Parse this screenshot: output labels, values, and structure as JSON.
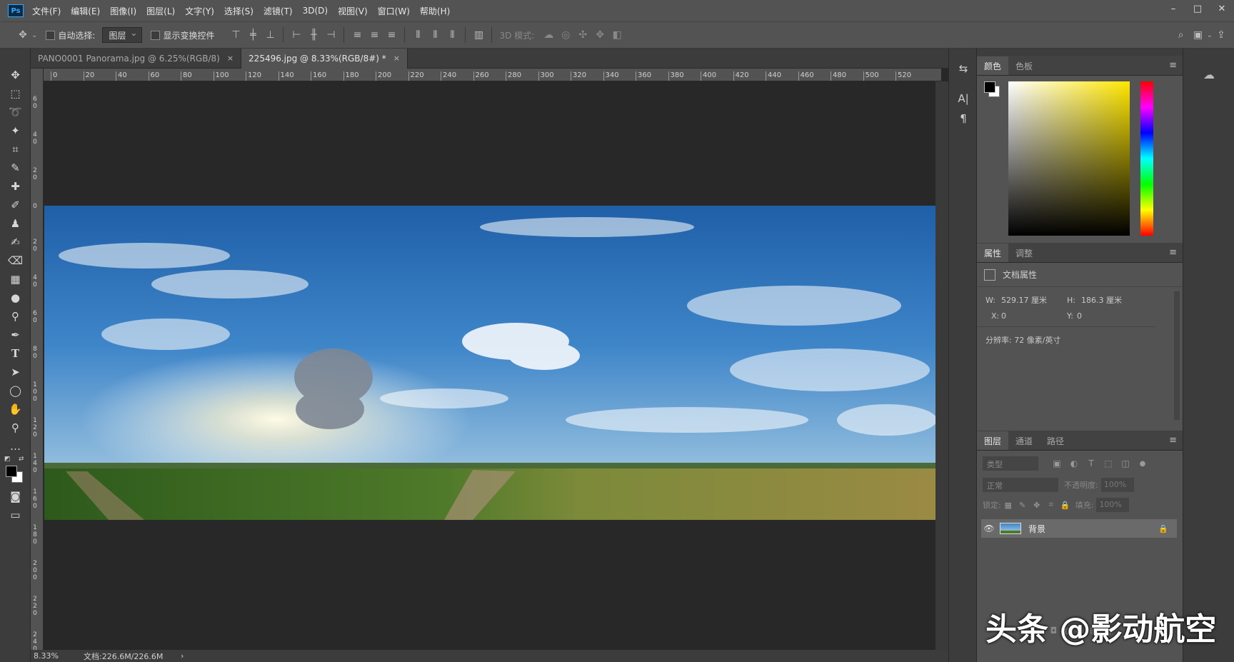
{
  "menu": {
    "app_logo": "Ps",
    "items": [
      "文件(F)",
      "编辑(E)",
      "图像(I)",
      "图层(L)",
      "文字(Y)",
      "选择(S)",
      "滤镜(T)",
      "3D(D)",
      "视图(V)",
      "窗口(W)",
      "帮助(H)"
    ]
  },
  "options": {
    "auto_select_label": "自动选择:",
    "auto_select_value": "图层",
    "show_transform_label": "显示变换控件",
    "mode_3d_label": "3D 模式:"
  },
  "tabs": [
    {
      "label": "PANO0001 Panorama.jpg @ 6.25%(RGB/8)",
      "close": "×"
    },
    {
      "label": "225496.jpg @ 8.33%(RGB/8#) *",
      "close": "×"
    }
  ],
  "ruler": {
    "h": [
      "0",
      "20",
      "40",
      "60",
      "80",
      "100",
      "120",
      "140",
      "160",
      "180",
      "200",
      "220",
      "240",
      "260",
      "280",
      "300",
      "320",
      "340",
      "360",
      "380",
      "400",
      "420",
      "440",
      "460",
      "480",
      "500",
      "520"
    ],
    "v": [
      "6 0",
      "4 0",
      "2 0",
      "0",
      "2 0",
      "4 0",
      "6 0",
      "8 0",
      "1 0 0",
      "1 2 0",
      "1 4 0",
      "1 6 0",
      "1 8 0",
      "2 0 0",
      "2 2 0",
      "2 4 0"
    ]
  },
  "status": {
    "zoom": "8.33%",
    "doc": "文档:226.6M/226.6M",
    "arrow": "›"
  },
  "color_panel": {
    "tabs": [
      "颜色",
      "色板"
    ]
  },
  "properties_panel": {
    "tabs": [
      "属性",
      "调整"
    ],
    "title": "文档属性",
    "w_label": "W:",
    "w_value": "529.17 厘米",
    "h_label": "H:",
    "h_value": "186.3 厘米",
    "x_label": "X:",
    "x_value": "0",
    "y_label": "Y:",
    "y_value": "0",
    "resolution": "分辨率: 72 像素/英寸"
  },
  "layers_panel": {
    "tabs": [
      "图层",
      "通道",
      "路径"
    ],
    "filter_placeholder": "类型",
    "blend_mode": "正常",
    "opacity_label": "不透明度:",
    "opacity_value": "100%",
    "lock_label": "锁定:",
    "fill_label": "填充:",
    "fill_value": "100%",
    "layers": [
      {
        "name": "背景"
      }
    ]
  },
  "watermark": "头条 @影动航空",
  "colors": {
    "accent": "#31a8ff",
    "panel_bg": "#535353",
    "dark_bg": "#282828"
  }
}
